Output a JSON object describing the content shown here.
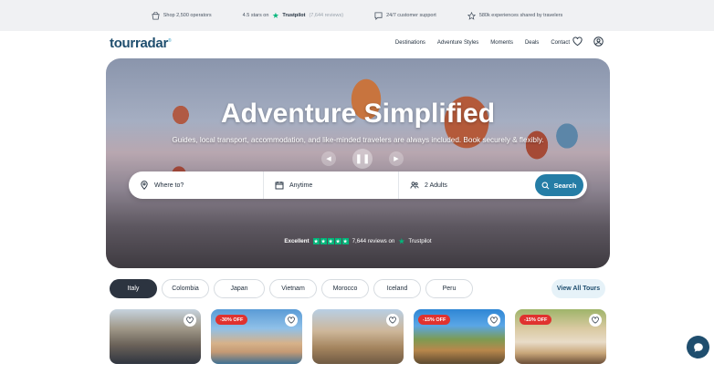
{
  "topbar": {
    "operators": "Shop 2,500 operators",
    "stars_prefix": "4.5 stars on",
    "trustpilot": "Trustpilot",
    "reviews": "(7,644 reviews)",
    "support": "24/7 customer support",
    "experiences": "580k experiences shared by travelers"
  },
  "nav": {
    "logo": "tourradar",
    "links": [
      "Destinations",
      "Adventure Styles",
      "Moments",
      "Deals",
      "Contact"
    ]
  },
  "hero": {
    "title": "Adventure Simplified",
    "subtitle": "Guides, local transport, accommodation, and like-minded travelers are always included. Book securely & flexibly.",
    "search": {
      "where_placeholder": "Where to?",
      "when_value": "Anytime",
      "guests_value": "2 Adults",
      "button_label": "Search"
    },
    "trustpilot": {
      "rating_word": "Excellent",
      "reviews_text": "7,644 reviews on",
      "brand": "Trustpilot"
    }
  },
  "tabs": [
    "Italy",
    "Colombia",
    "Japan",
    "Vietnam",
    "Morocco",
    "Iceland",
    "Peru"
  ],
  "view_all": "View All Tours",
  "cards": [
    {
      "badge": ""
    },
    {
      "badge": "-30% OFF"
    },
    {
      "badge": ""
    },
    {
      "badge": "-15% OFF"
    },
    {
      "badge": "-15% OFF"
    }
  ],
  "colors": {
    "brand": "#1f4e6e",
    "search_button": "#257da6",
    "trustpilot_green": "#00b67a",
    "discount_badge": "#e0322f"
  }
}
